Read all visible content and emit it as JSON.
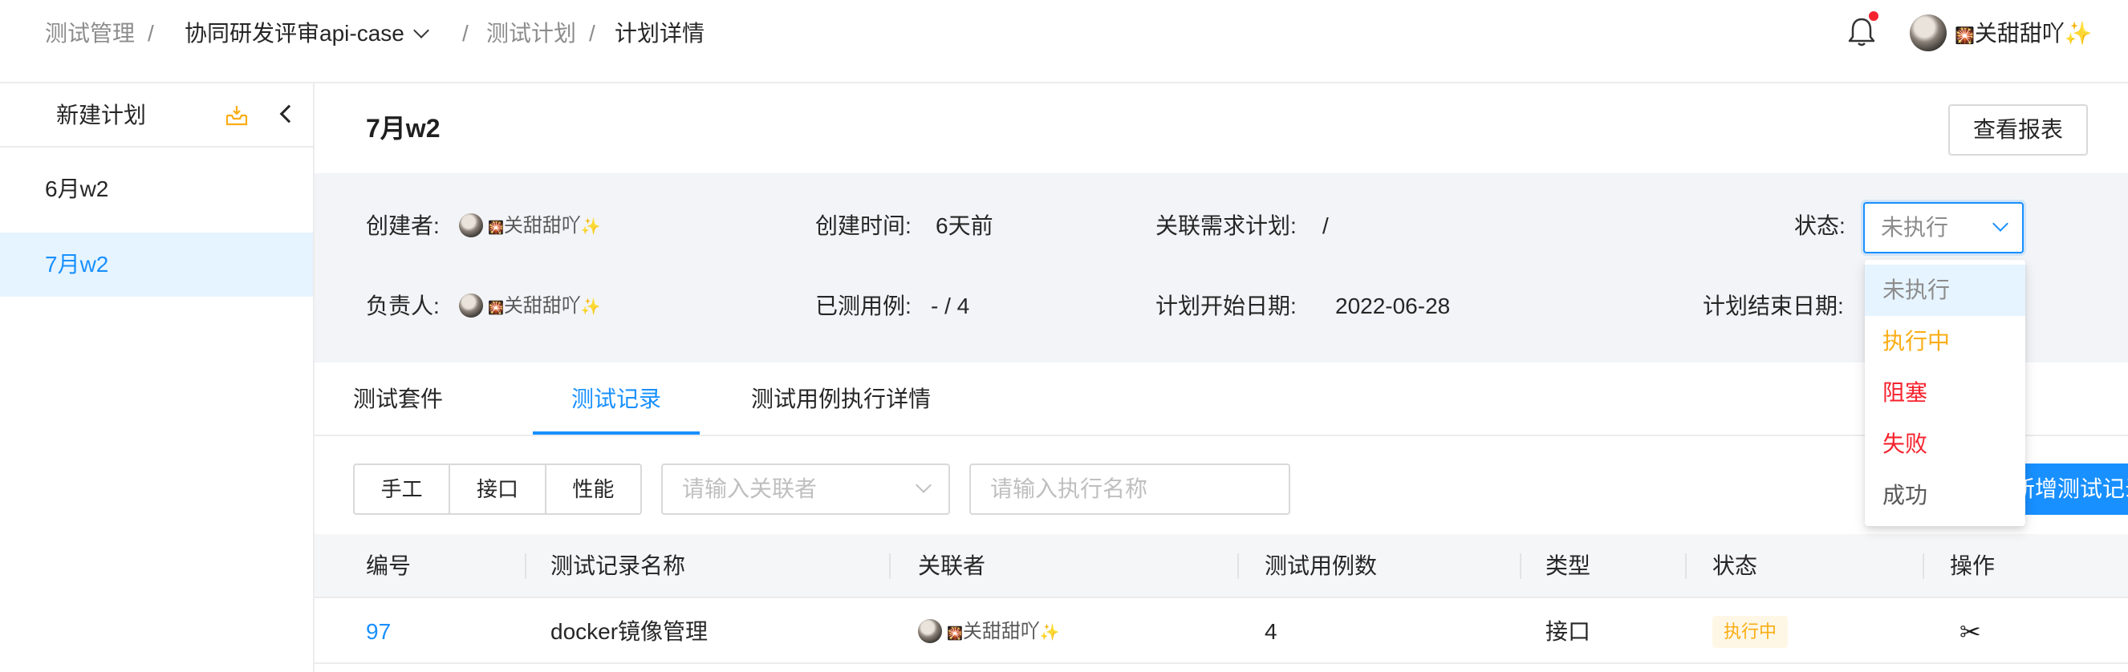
{
  "breadcrumb": {
    "item1": "测试管理",
    "sep": "/",
    "item2": "协同研发评审api-case",
    "item3": "测试计划",
    "item4": "计划详情"
  },
  "header": {
    "user_name": "关甜甜吖",
    "user_prefix": "🎇",
    "user_suffix": "✨"
  },
  "sidebar": {
    "new_plan": "新建计划",
    "items": [
      {
        "label": "6月w2"
      },
      {
        "label": "7月w2"
      }
    ]
  },
  "plan": {
    "title": "7月w2",
    "report_button": "查看报表"
  },
  "info": {
    "creator_label": "创建者:",
    "creator": "关甜甜吖",
    "owner_label": "负责人:",
    "owner": "关甜甜吖",
    "created_label": "创建时间:",
    "created_value": "6天前",
    "tested_label": "已测用例:",
    "tested_value": "- / 4",
    "req_label": "关联需求计划:",
    "req_value": "/",
    "start_label": "计划开始日期:",
    "start_value": "2022-06-28",
    "status_label": "状态:",
    "status_value": "未执行",
    "end_label": "计划结束日期:"
  },
  "status_options": [
    {
      "label": "未执行",
      "color": "#8c8c8c"
    },
    {
      "label": "执行中",
      "color": "#faad14"
    },
    {
      "label": "阻塞",
      "color": "#f5222d"
    },
    {
      "label": "失败",
      "color": "#f5222d"
    },
    {
      "label": "成功",
      "color": "#595959"
    }
  ],
  "tabs": [
    "测试套件",
    "测试记录",
    "测试用例执行详情"
  ],
  "filters": {
    "segments": [
      "手工",
      "接口",
      "性能"
    ],
    "related_placeholder": "请输入关联者",
    "name_placeholder": "请输入执行名称",
    "add_button": "新增测试记录"
  },
  "table": {
    "headers": [
      "编号",
      "测试记录名称",
      "关联者",
      "测试用例数",
      "类型",
      "状态",
      "操作"
    ],
    "rows": [
      {
        "id": "97",
        "name": "docker镜像管理",
        "related": "关甜甜吖",
        "cases": "4",
        "type": "接口",
        "status": "执行中"
      }
    ]
  },
  "colors": {
    "accent": "#1890ff",
    "warning": "#faad14",
    "danger": "#f5222d"
  }
}
